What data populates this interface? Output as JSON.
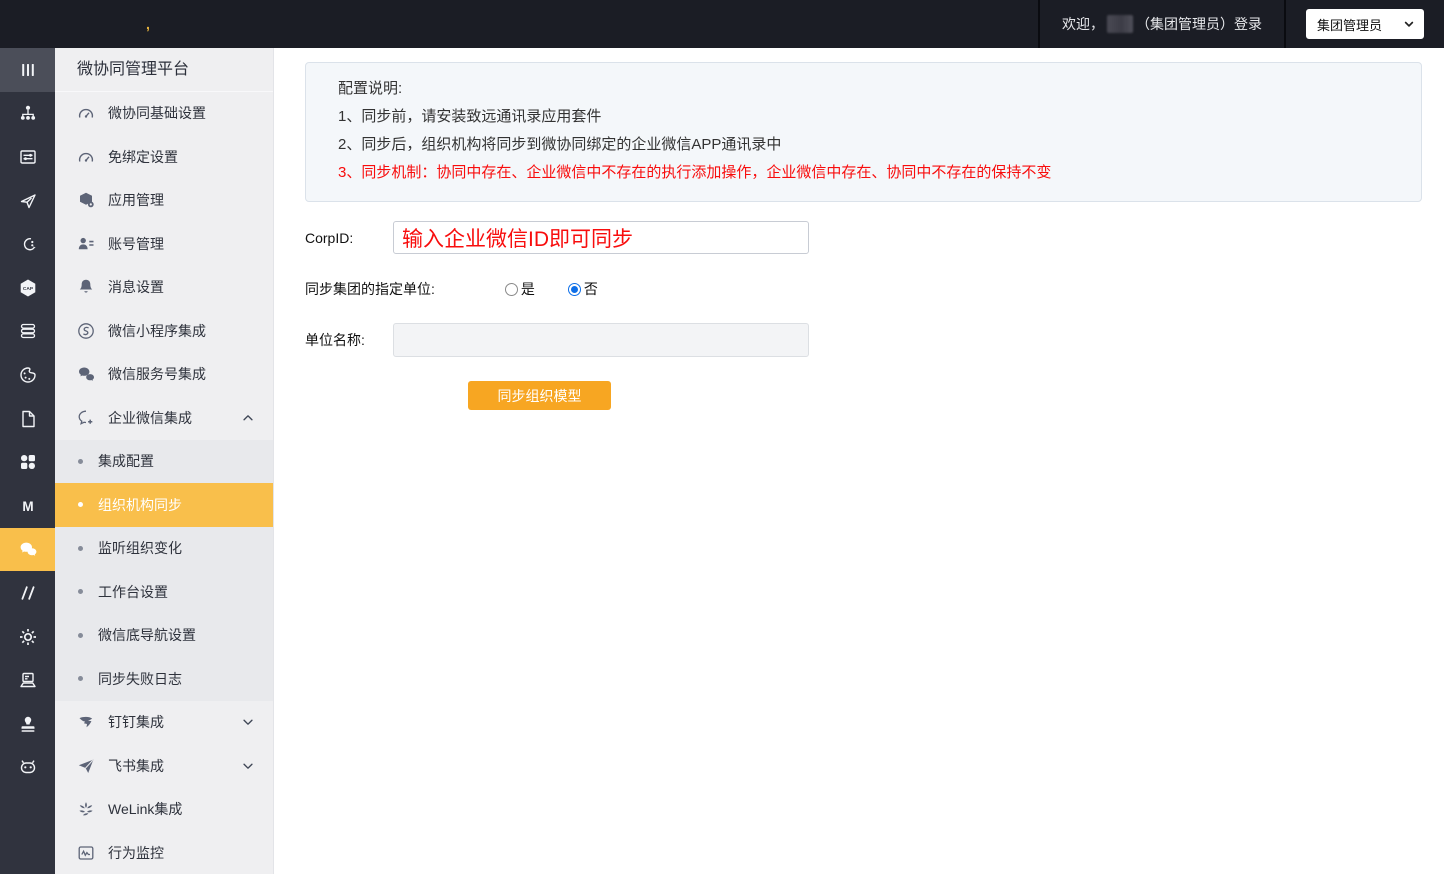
{
  "colors": {
    "topbar_bg": "#1b1d25",
    "rail_bg": "#30333e",
    "accent_yellow": "#f9bf4b",
    "button_orange": "#f7a622",
    "note_red": "#f80d0d",
    "radio_blue": "#0e6fe8",
    "sidebar_bg": "#efeff1",
    "submenu_bg": "#e8e9ec"
  },
  "topbar": {
    "logo_mark": ",",
    "welcome_prefix": "欢迎，",
    "welcome_suffix": "（集团管理员）登录",
    "role_select_value": "集团管理员"
  },
  "rail": {
    "items": [
      {
        "icon": "menu-bars-icon",
        "variant": "header"
      },
      {
        "icon": "org-chart-icon"
      },
      {
        "icon": "settings-panel-icon"
      },
      {
        "icon": "cursor-arrow-icon"
      },
      {
        "icon": "flow-link-icon"
      },
      {
        "icon": "cap-badge-icon",
        "text": "CAP"
      },
      {
        "icon": "stack-icon"
      },
      {
        "icon": "palette-icon"
      },
      {
        "icon": "document-icon"
      },
      {
        "icon": "shapes-grid-icon"
      },
      {
        "icon": "letter-m-icon",
        "text": "M"
      },
      {
        "icon": "wechat-icon",
        "active": true
      },
      {
        "icon": "code-icon"
      },
      {
        "icon": "gear-icon"
      },
      {
        "icon": "laptop-icon"
      },
      {
        "icon": "stamp-icon"
      },
      {
        "icon": "robot-icon"
      }
    ]
  },
  "sidebar": {
    "title": "微协同管理平台",
    "items": [
      {
        "label": "微协同基础设置",
        "icon": "gauge-icon"
      },
      {
        "label": "免绑定设置",
        "icon": "gauge-icon"
      },
      {
        "label": "应用管理",
        "icon": "cube-gear-icon"
      },
      {
        "label": "账号管理",
        "icon": "user-list-icon"
      },
      {
        "label": "消息设置",
        "icon": "bell-icon"
      },
      {
        "label": "微信小程序集成",
        "icon": "miniprogram-icon"
      },
      {
        "label": "微信服务号集成",
        "icon": "chat-bubbles-icon"
      },
      {
        "label": "企业微信集成",
        "icon": "wecom-bubble-icon",
        "expandable": true,
        "expanded": true,
        "children": [
          {
            "label": "集成配置"
          },
          {
            "label": "组织机构同步",
            "active": true
          },
          {
            "label": "监听组织变化"
          },
          {
            "label": "工作台设置"
          },
          {
            "label": "微信底导航设置"
          },
          {
            "label": "同步失败日志"
          }
        ]
      },
      {
        "label": "钉钉集成",
        "icon": "dingtalk-icon",
        "expandable": true,
        "expanded": false
      },
      {
        "label": "飞书集成",
        "icon": "feishu-icon",
        "expandable": true,
        "expanded": false
      },
      {
        "label": "WeLink集成",
        "icon": "welink-icon"
      },
      {
        "label": "行为监控",
        "icon": "monitor-icon"
      }
    ]
  },
  "main": {
    "notice": {
      "title": "配置说明:",
      "lines": [
        {
          "text": "1、同步前，请安装致远通讯录应用套件",
          "color": "default"
        },
        {
          "text": "2、同步后，组织机构将同步到微协同绑定的企业微信APP通讯录中",
          "color": "default"
        },
        {
          "text": "3、同步机制：协同中存在、企业微信中不存在的执行添加操作，企业微信中存在、协同中不存在的保持不变",
          "color": "red"
        }
      ]
    },
    "form": {
      "corpid_label": "CorpID:",
      "corpid_value": "输入企业微信ID即可同步",
      "sync_unit_label": "同步集团的指定单位:",
      "radio_yes_label": "是",
      "radio_no_label": "否",
      "radio_selected": "no",
      "unit_name_label": "单位名称:",
      "unit_name_value": "",
      "sync_button_label": "同步组织模型"
    }
  }
}
